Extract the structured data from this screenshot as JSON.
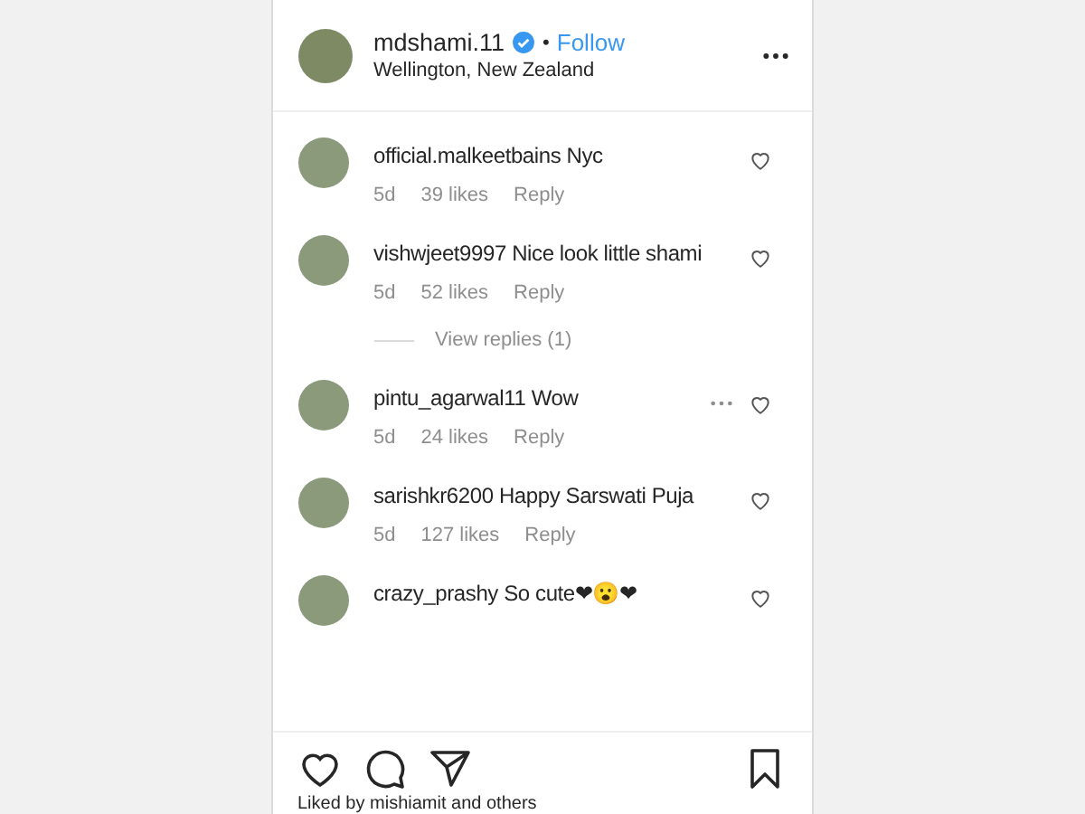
{
  "header": {
    "username": "mdshami.11",
    "verified": true,
    "separator": "•",
    "follow": "Follow",
    "location": "Wellington, New Zealand"
  },
  "comments": [
    {
      "user": "official.malkeetbains",
      "text": "Nyc",
      "time": "5d",
      "likes": "39 likes",
      "reply": "Reply",
      "show_more": false
    },
    {
      "user": "vishwjeet9997",
      "text": "Nice look little shami",
      "time": "5d",
      "likes": "52 likes",
      "reply": "Reply",
      "show_more": false,
      "view_replies": "View replies (1)"
    },
    {
      "user": "pintu_agarwal11",
      "text": "Wow",
      "time": "5d",
      "likes": "24 likes",
      "reply": "Reply",
      "show_more": true
    },
    {
      "user": "sarishkr6200",
      "text": "Happy Sarswati Puja",
      "time": "5d",
      "likes": "127 likes",
      "reply": "Reply",
      "show_more": false
    },
    {
      "user": "crazy_prashy",
      "text": "So cute❤😮❤",
      "show_more": false
    }
  ],
  "footer": {
    "liked_by": "Liked by mishiamit and others"
  }
}
